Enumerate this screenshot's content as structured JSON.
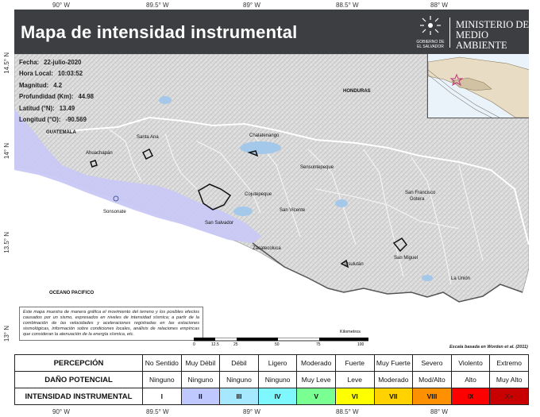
{
  "header": {
    "title": "Mapa de intensidad instrumental",
    "ministry_line1": "MINISTERIO DE",
    "ministry_line2": "MEDIO AMBIENTE",
    "seal_line1": "GOBIERNO DE",
    "seal_line2": "EL SALVADOR"
  },
  "coords": {
    "top": [
      "90° W",
      "89.5° W",
      "89° W",
      "88.5° W",
      "88° W"
    ],
    "bottom": [
      "90° W",
      "89.5° W",
      "89° W",
      "88.5° W",
      "88° W"
    ],
    "left": [
      "14.5° N",
      "14° N",
      "13.5° N",
      "13° N"
    ]
  },
  "event": {
    "fecha_label": "Fecha:",
    "fecha": "22-julio-2020",
    "hora_label": "Hora Local:",
    "hora": "10:03:52",
    "magnitud_label": "Magnitud:",
    "magnitud": "4.2",
    "profundidad_label": "Profundidad (Km):",
    "profundidad": "44.98",
    "latitud_label": "Latitud (°N):",
    "latitud": "13.49",
    "longitud_label": "Longitud (°O):",
    "longitud": "-90.569"
  },
  "places": {
    "guatemala": "GUATEMALA",
    "honduras": "HONDURAS",
    "ocean": "OCEANO PACIFICO",
    "ahuachapan": "Ahuachapán",
    "santa_ana": "Santa Ana",
    "chalatenango": "Chalatenango",
    "sonsonate": "Sonsonate",
    "cojutepeque": "Cojutepeque",
    "sensuntepeque": "Sensuntepeque",
    "san_salvador": "San Salvador",
    "san_vicente": "San Vicente",
    "zacatecoluca": "Zacatecoluca",
    "san_francisco": "San Francisco",
    "gotera": "Gotera",
    "usulutan": "Usulután",
    "san_miguel": "San Miguel",
    "la_union": "La Unión"
  },
  "note": "Este mapa muestra de manera gráfica el movimiento del terreno y los posibles efectos causados por un sismo, expresados en niveles de intensidad sísmica; a partir de la combinación de las velocidades y aceleraciones registradas en las estaciones sismológicas, información sobre condiciones locales, análisis de relaciones empíricas que consideran la atenuación de la energía sísmica, etc.",
  "scale": {
    "label": "Kilometros",
    "ticks": [
      "0",
      "12.5",
      "25",
      "50",
      "75",
      "100"
    ],
    "credit": "Escala basada en Worden et al. (2011)"
  },
  "legend": {
    "perception_header": "PERCEPCIÓN",
    "damage_header": "DAÑO POTENCIAL",
    "intensity_header": "INTENSIDAD INSTRUMENTAL",
    "perception": [
      "No Sentido",
      "Muy Débil",
      "Débil",
      "Ligero",
      "Moderado",
      "Fuerte",
      "Muy Fuerte",
      "Severo",
      "Violento",
      "Extremo"
    ],
    "damage": [
      "Ninguno",
      "Ninguno",
      "Ninguno",
      "Ninguno",
      "Muy Leve",
      "Leve",
      "Moderado",
      "Mod/Alto",
      "Alto",
      "Muy Alto"
    ],
    "intensity": [
      "I",
      "II",
      "III",
      "IV",
      "V",
      "VI",
      "VII",
      "VIII",
      "IX",
      "X+"
    ],
    "colors": [
      "#ffffff",
      "#bfc8ff",
      "#a6e8ff",
      "#7ef7ff",
      "#79ff92",
      "#ffff00",
      "#ffd200",
      "#ff9100",
      "#ff0000",
      "#c80000"
    ]
  },
  "map_colors": {
    "ocean": "#ffffff",
    "intensity_ii": "#c8c8f5",
    "lakes": "#a3c8ea",
    "land": "#d9d9d9"
  }
}
